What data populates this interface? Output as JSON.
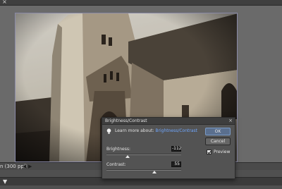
{
  "tab": {
    "close_glyph": "×",
    "close_icon": "close-icon"
  },
  "status": {
    "zoom_text": "n (300 ppi)",
    "nav_left": "◀",
    "nav_right": "▶"
  },
  "panel": {
    "toggle_glyph": "▼"
  },
  "dialog": {
    "title": "Brightness/Contrast",
    "close_glyph": "×",
    "learn_prefix": "Learn more about:",
    "learn_link": "Brightness/Contrast",
    "ok_label": "OK",
    "cancel_label": "Cancel",
    "preview_label": "Preview",
    "preview_checked": true,
    "brightness_label": "Brightness:",
    "brightness_value": "-112",
    "brightness_level": 0.28,
    "contrast_label": "Contrast:",
    "contrast_value": "55",
    "contrast_level": 0.64
  },
  "colors": {
    "link": "#6fa7ff",
    "ok_accent": "#5a6f8e",
    "photo_frame": "#8a8aa8"
  }
}
